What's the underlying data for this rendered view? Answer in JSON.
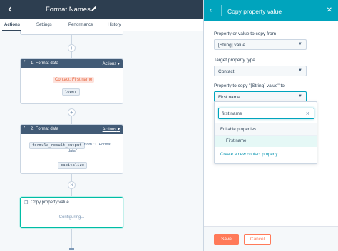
{
  "header": {
    "workflow_title": "Format Names"
  },
  "tabs": [
    {
      "label": "Actions"
    },
    {
      "label": "Settings"
    },
    {
      "label": "Performance"
    },
    {
      "label": "History"
    }
  ],
  "actions": {
    "step1": {
      "fx": "f",
      "title": "1. Format data",
      "actions_label": "Actions",
      "source_token": "Contact: First name",
      "operation": "lower"
    },
    "step2": {
      "fx": "f",
      "title": "2. Format data",
      "actions_label": "Actions",
      "source_token": "formula_result_output",
      "source_suffix": "from \"1. Format",
      "source_suffix2": "data\"",
      "operation": "capitalize"
    },
    "step3": {
      "title": "Copy property value",
      "status": "Configuring..."
    }
  },
  "panel": {
    "title": "Copy property value",
    "field1": {
      "label": "Property or value to copy from",
      "value": "[String] value"
    },
    "field2": {
      "label": "Target property type",
      "value": "Contact"
    },
    "field3": {
      "label": "Property to copy \"[String] value\" to",
      "value": "First name"
    },
    "dropdown": {
      "search_value": "first name",
      "section_label": "Editable properties",
      "item": "First name",
      "create_link": "Create a new contact property"
    },
    "footer": {
      "save_label": "Save",
      "cancel_label": "Cancel"
    }
  },
  "colors": {
    "topbar": "#2d3e50",
    "panel_header": "#00a4bd",
    "card_header": "#425b76",
    "accent_orange": "#ff7a59",
    "config_border": "#00bda5"
  }
}
